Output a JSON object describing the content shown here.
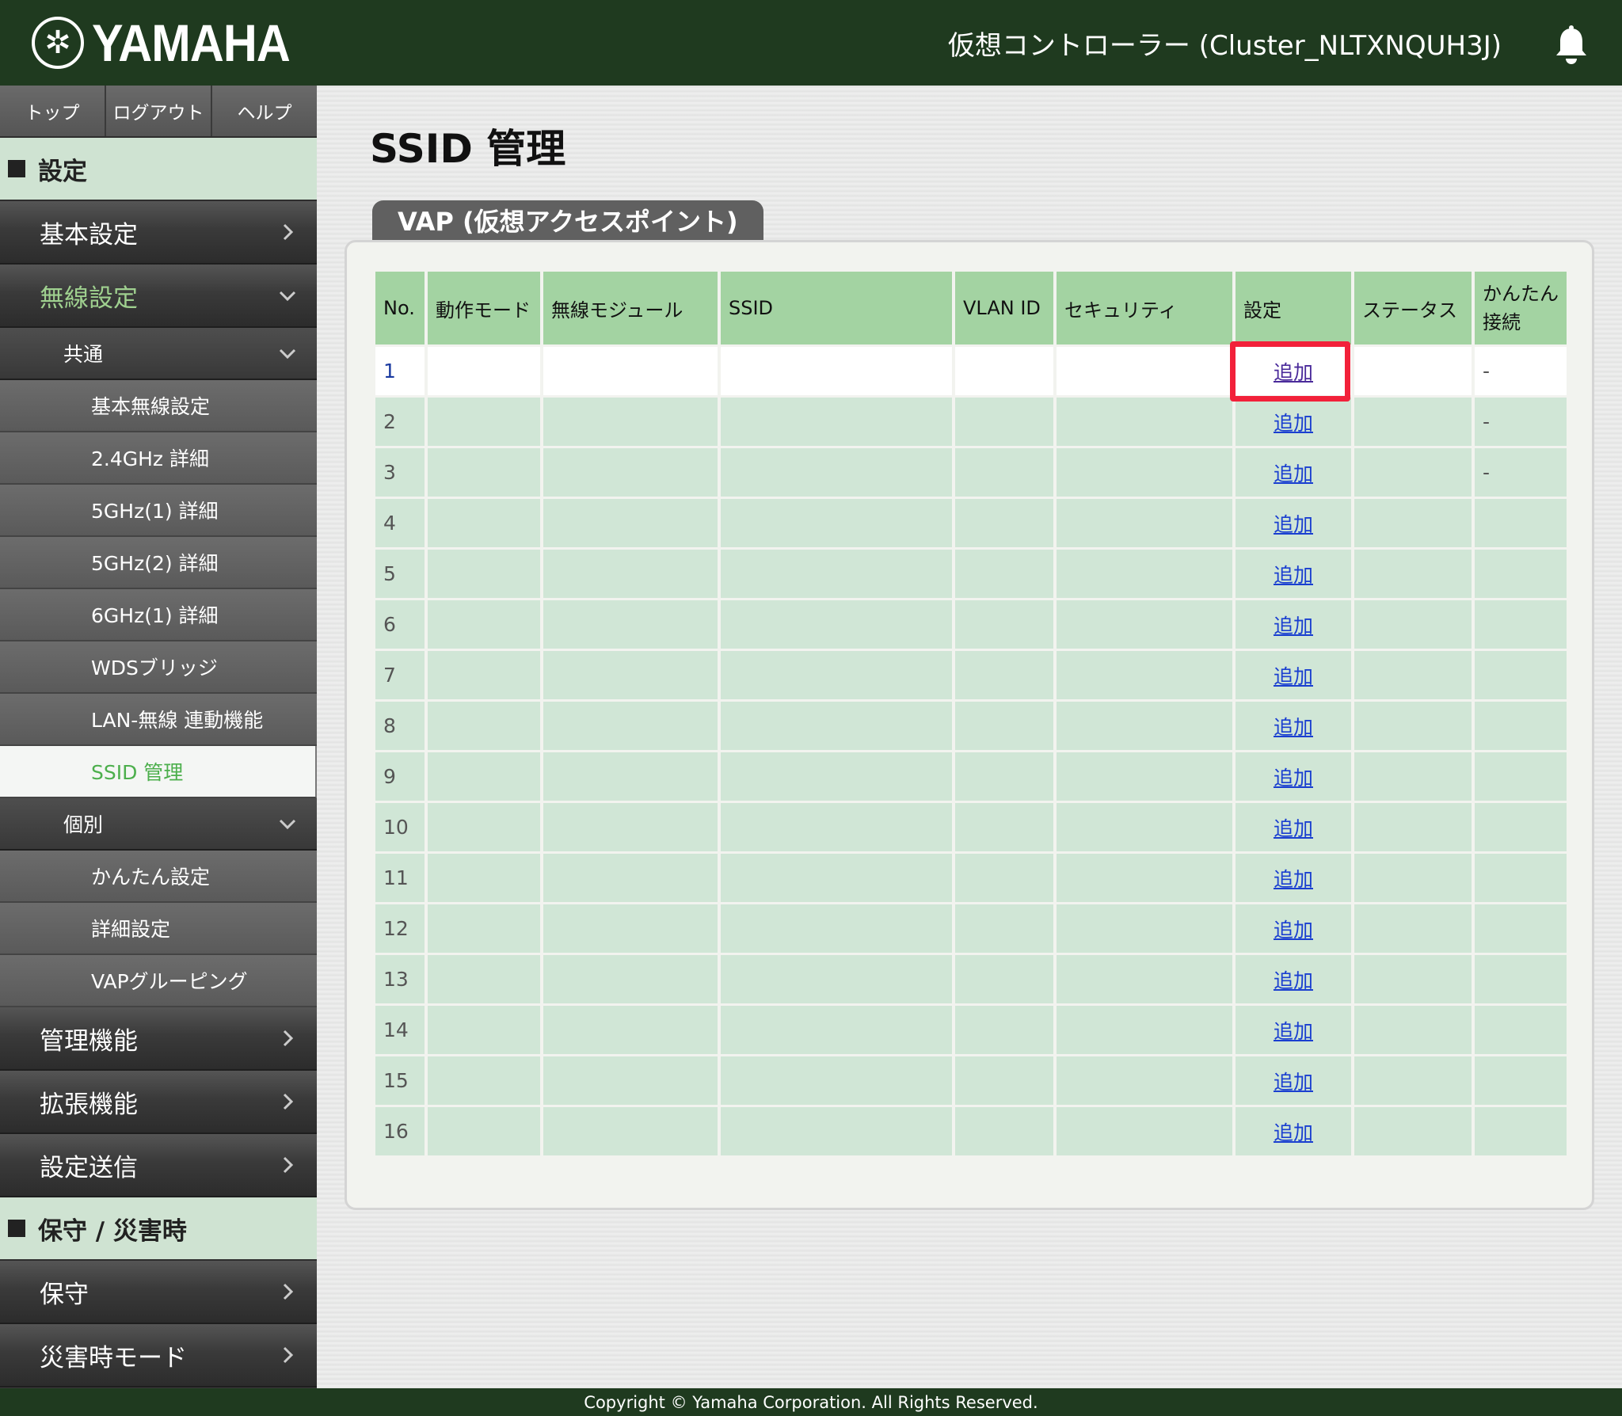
{
  "header": {
    "brand": "YAMAHA",
    "controller_title": "仮想コントローラー (Cluster_NLTXNQUH3J)"
  },
  "topnav": [
    "トップ",
    "ログアウト",
    "ヘルプ"
  ],
  "sidebar": {
    "section_settings": "設定",
    "basic_settings": "基本設定",
    "wireless_settings": "無線設定",
    "common": "共通",
    "common_items": [
      "基本無線設定",
      "2.4GHz 詳細",
      "5GHz(1) 詳細",
      "5GHz(2) 詳細",
      "6GHz(1) 詳細",
      "WDSブリッジ",
      "LAN-無線 連動機能",
      "SSID 管理"
    ],
    "individual": "個別",
    "individual_items": [
      "かんたん設定",
      "詳細設定",
      "VAPグルーピング"
    ],
    "management": "管理機能",
    "extended": "拡張機能",
    "send_settings": "設定送信",
    "section_maintenance": "保守 / 災害時",
    "maintenance": "保守",
    "disaster_mode": "災害時モード"
  },
  "main": {
    "title": "SSID 管理",
    "tab_label": "VAP (仮想アクセスポイント)",
    "columns": [
      "No.",
      "動作モード",
      "無線モジュール",
      "SSID",
      "VLAN ID",
      "セキュリティ",
      "設定",
      "ステータス",
      "かんたん接続"
    ],
    "rows": [
      {
        "no": "1",
        "setting": "追加",
        "easy": "-"
      },
      {
        "no": "2",
        "setting": "追加",
        "easy": "-"
      },
      {
        "no": "3",
        "setting": "追加",
        "easy": "-"
      },
      {
        "no": "4",
        "setting": "追加",
        "easy": ""
      },
      {
        "no": "5",
        "setting": "追加",
        "easy": ""
      },
      {
        "no": "6",
        "setting": "追加",
        "easy": ""
      },
      {
        "no": "7",
        "setting": "追加",
        "easy": ""
      },
      {
        "no": "8",
        "setting": "追加",
        "easy": ""
      },
      {
        "no": "9",
        "setting": "追加",
        "easy": ""
      },
      {
        "no": "10",
        "setting": "追加",
        "easy": ""
      },
      {
        "no": "11",
        "setting": "追加",
        "easy": ""
      },
      {
        "no": "12",
        "setting": "追加",
        "easy": ""
      },
      {
        "no": "13",
        "setting": "追加",
        "easy": ""
      },
      {
        "no": "14",
        "setting": "追加",
        "easy": ""
      },
      {
        "no": "15",
        "setting": "追加",
        "easy": ""
      },
      {
        "no": "16",
        "setting": "追加",
        "easy": ""
      }
    ]
  },
  "footer": {
    "copyright": "Copyright © Yamaha Corporation. All Rights Reserved."
  },
  "colors": {
    "header_bg": "#1f3a1f",
    "table_header": "#a3d3a2",
    "table_row": "#d0e6d6",
    "highlight": "#f2213a",
    "active_menu_text": "#4caf4c"
  }
}
